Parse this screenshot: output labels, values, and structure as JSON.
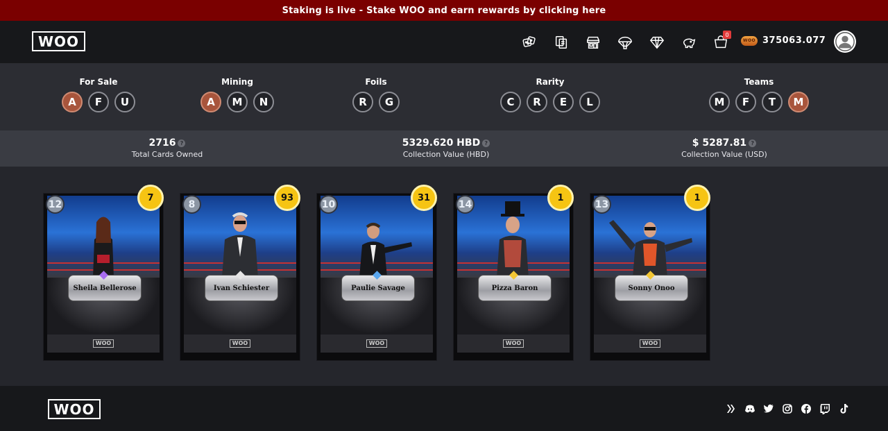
{
  "banner": {
    "text": "Staking is live - Stake WOO and earn rewards by clicking here"
  },
  "header": {
    "logo": "WOO",
    "nav_icons": [
      "dice-icon",
      "cards-icon",
      "store-icon",
      "parachute-icon",
      "diamond-icon",
      "piggy-bank-icon",
      "cart-icon"
    ],
    "cart_badge": "0",
    "balance": "375063.077"
  },
  "filters": [
    {
      "title": "For Sale",
      "options": [
        "A",
        "F",
        "U"
      ],
      "active": 0
    },
    {
      "title": "Mining",
      "options": [
        "A",
        "M",
        "N"
      ],
      "active": 0
    },
    {
      "title": "Foils",
      "options": [
        "R",
        "G"
      ],
      "active": -1
    },
    {
      "title": "Rarity",
      "options": [
        "C",
        "R",
        "E",
        "L"
      ],
      "active": -1
    },
    {
      "title": "Teams",
      "options": [
        "M",
        "F",
        "T",
        "M"
      ],
      "active": 3
    }
  ],
  "stats": [
    {
      "value": "2716",
      "label": "Total Cards Owned"
    },
    {
      "value": "5329.620 HBD",
      "label": "Collection Value (HBD)"
    },
    {
      "value": "$ 5287.81",
      "label": "Collection Value (USD)"
    }
  ],
  "cards": [
    {
      "name": "Sheila Bellerose",
      "level": "12",
      "count": "7",
      "gem_color": "#a86cf0"
    },
    {
      "name": "Ivan Schiester",
      "level": "8",
      "count": "93",
      "gem_color": "#e5e5e5"
    },
    {
      "name": "Paulie Savage",
      "level": "10",
      "count": "31",
      "gem_color": "#5aa7ef"
    },
    {
      "name": "Pizza Baron",
      "level": "14",
      "count": "1",
      "gem_color": "#f2c634"
    },
    {
      "name": "Sonny Onoo",
      "level": "13",
      "count": "1",
      "gem_color": "#f2c634"
    }
  ],
  "card_brand": "WOO",
  "footer": {
    "logo": "WOO",
    "socials": [
      "hive-icon",
      "discord-icon",
      "twitter-icon",
      "instagram-icon",
      "facebook-icon",
      "twitch-icon",
      "tiktok-icon"
    ]
  },
  "colors": {
    "banner": "#7a0000",
    "active_filter": "#a8553c",
    "count_badge": "#f6c413"
  }
}
